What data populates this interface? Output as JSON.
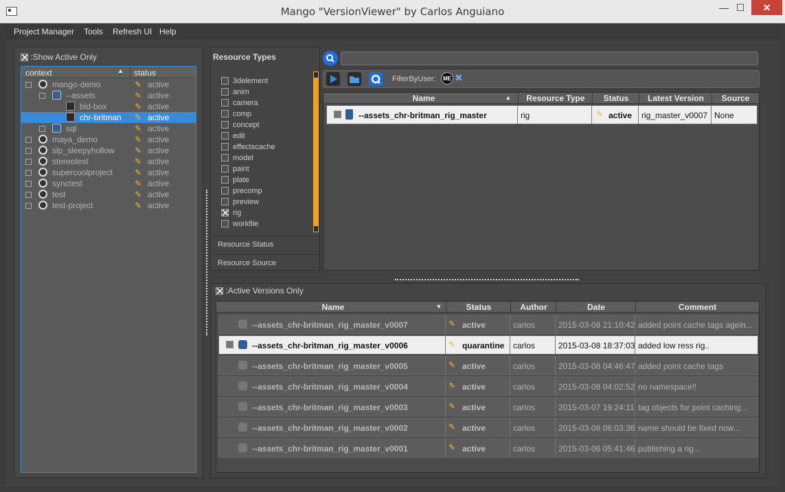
{
  "window": {
    "title": "Mango \"VersionViewer\" by Carlos Anguiano",
    "minimize": "—",
    "maximize": "☐",
    "close": "✕"
  },
  "menu": [
    "Project Manager",
    "Tools",
    "Refresh UI",
    "Help"
  ],
  "left": {
    "show_active_only": ":Show Active Only",
    "columns": [
      "context",
      "status"
    ],
    "tree": [
      {
        "label": "mango-demo",
        "status": "active"
      },
      {
        "label": "--assets",
        "status": "active"
      },
      {
        "label": "bld-box",
        "status": "active"
      },
      {
        "label": "chr-britman",
        "status": "active",
        "selected": true
      },
      {
        "label": "sql",
        "status": "active"
      },
      {
        "label": "maya_demo",
        "status": "active"
      },
      {
        "label": "slp_sleepyhollow",
        "status": "active"
      },
      {
        "label": "stereotest",
        "status": "active"
      },
      {
        "label": "supercoolproject",
        "status": "active"
      },
      {
        "label": "synctest",
        "status": "active"
      },
      {
        "label": "test",
        "status": "active"
      },
      {
        "label": "test-project",
        "status": "active"
      }
    ]
  },
  "resource_types": {
    "title": "Resource Types",
    "items": [
      "3delement",
      "anim",
      "camera",
      "comp",
      "concept",
      "edit",
      "effectscache",
      "model",
      "paint",
      "plate",
      "precomp",
      "preview",
      "rig",
      "workfile"
    ],
    "checked": "rig",
    "tabs": [
      "Resource Status",
      "Resource Source"
    ]
  },
  "toolbar": {
    "filter_label": "FilterByUser:",
    "user_badge": "ME"
  },
  "resources": {
    "columns": [
      "Name",
      "Resource Type",
      "Status",
      "Latest Version",
      "Source"
    ],
    "rows": [
      {
        "name": "--assets_chr-britman_rig_master",
        "type": "rig",
        "status": "active",
        "latest": "rig_master_v0007",
        "source": "None"
      }
    ]
  },
  "versions": {
    "active_only": ":Active Versions Only",
    "columns": [
      "Name",
      "Status",
      "Author",
      "Date",
      "Comment"
    ],
    "rows": [
      {
        "name": "--assets_chr-britman_rig_master_v0007",
        "status": "active",
        "author": "carlos",
        "date": "2015-03-08 21:10:42",
        "comment": "added point cache tags agein..."
      },
      {
        "name": "--assets_chr-britman_rig_master_v0006",
        "status": "quarantine",
        "author": "carlos",
        "date": "2015-03-08 18:37:03",
        "comment": "added low ress rig..",
        "highlight": true
      },
      {
        "name": "--assets_chr-britman_rig_master_v0005",
        "status": "active",
        "author": "carlos",
        "date": "2015-03-08 04:46:47",
        "comment": "added point cache tags"
      },
      {
        "name": "--assets_chr-britman_rig_master_v0004",
        "status": "active",
        "author": "carlos",
        "date": "2015-03-08 04:02:52",
        "comment": "no namespace!!"
      },
      {
        "name": "--assets_chr-britman_rig_master_v0003",
        "status": "active",
        "author": "carlos",
        "date": "2015-03-07 19:24:11",
        "comment": "tag objects for point caching..."
      },
      {
        "name": "--assets_chr-britman_rig_master_v0002",
        "status": "active",
        "author": "carlos",
        "date": "2015-03-06 06:03:36",
        "comment": "name should be fixed now..."
      },
      {
        "name": "--assets_chr-britman_rig_master_v0001",
        "status": "active",
        "author": "carlos",
        "date": "2015-03-06 05:41:46",
        "comment": "publishing a rig..."
      }
    ]
  }
}
